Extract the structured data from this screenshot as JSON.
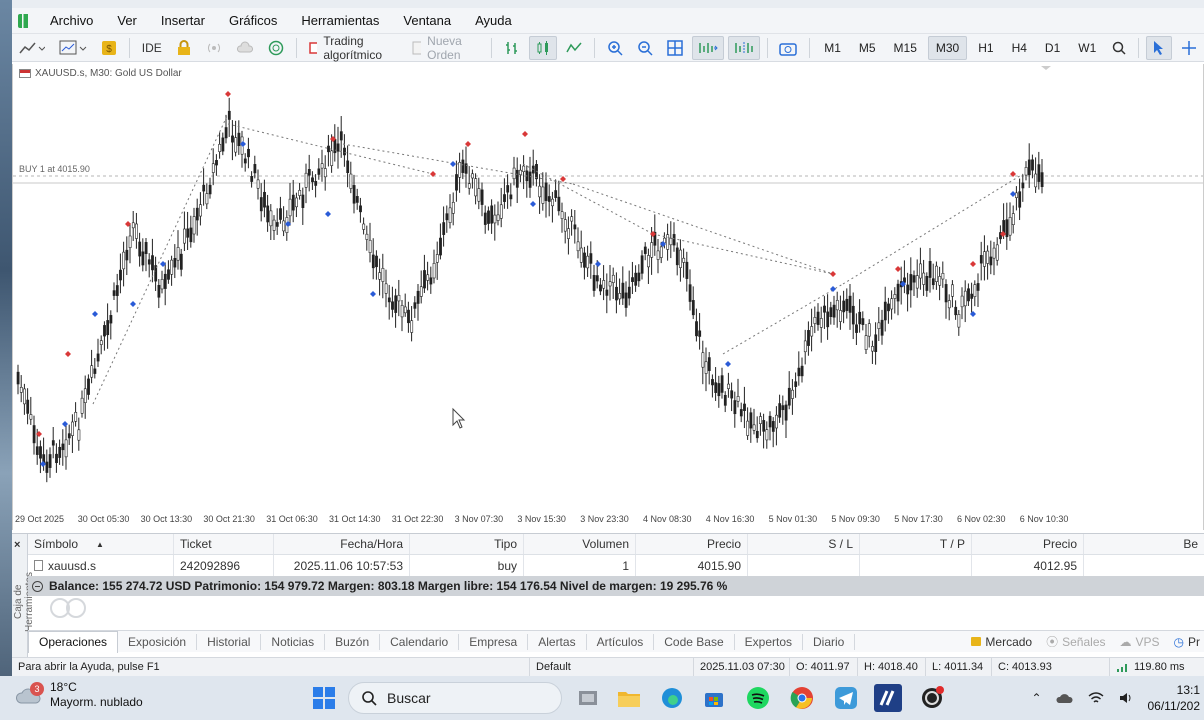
{
  "menubar": {
    "items": [
      "Archivo",
      "Ver",
      "Insertar",
      "Gráficos",
      "Herramientas",
      "Ventana",
      "Ayuda"
    ]
  },
  "toolbar": {
    "ide_label": "IDE",
    "algo_trading_label": "Trading algorítmico",
    "new_order_label": "Nueva Orden",
    "timeframes": [
      "M1",
      "M5",
      "M15",
      "M30",
      "H1",
      "H4",
      "D1",
      "W1"
    ],
    "active_timeframe": "M30"
  },
  "chart": {
    "title": "XAUUSD.s, M30:  Gold US Dollar",
    "buy_line_label": "BUY 1 at 4015.90",
    "dates": [
      "29 Oct 2025",
      "30 Oct 05:30",
      "30 Oct 13:30",
      "30 Oct 21:30",
      "31 Oct 06:30",
      "31 Oct 14:30",
      "31 Oct 22:30",
      "3 Nov 07:30",
      "3 Nov 15:30",
      "3 Nov 23:30",
      "4 Nov 08:30",
      "4 Nov 16:30",
      "5 Nov 01:30",
      "5 Nov 09:30",
      "5 Nov 17:30",
      "6 Nov 02:30",
      "6 Nov 10:30"
    ]
  },
  "terminal": {
    "side_label": "Caja de Herramientas",
    "columns": [
      "Símbolo",
      "Ticket",
      "Fecha/Hora",
      "Tipo",
      "Volumen",
      "Precio",
      "S / L",
      "T / P",
      "Precio",
      "Be"
    ],
    "rows": [
      {
        "symbol": "xauusd.s",
        "ticket": "242092896",
        "datetime": "2025.11.06 10:57:53",
        "type": "buy",
        "volume": "1",
        "price": "4015.90",
        "sl": "",
        "tp": "",
        "current_price": "4012.95"
      }
    ],
    "balance_line": "Balance: 155 274.72 USD  Patrimonio: 154 979.72  Margen: 803.18  Margen libre: 154 176.54  Nivel de margen: 19 295.76 %",
    "tabs": [
      "Operaciones",
      "Exposición",
      "Historial",
      "Noticias",
      "Buzón",
      "Calendario",
      "Empresa",
      "Alertas",
      "Artículos",
      "Code Base",
      "Expertos",
      "Diario"
    ],
    "active_tab": "Operaciones",
    "right_items": [
      "Mercado",
      "Señales",
      "VPS",
      "Pr"
    ]
  },
  "statusbar": {
    "help": "Para abrir la Ayuda, pulse F1",
    "profile": "Default",
    "datetime": "2025.11.03 07:30",
    "open": "O: 4011.97",
    "high": "H: 4018.40",
    "low": "L: 4011.34",
    "close": "C: 4013.93",
    "ping": "119.80 ms"
  },
  "taskbar": {
    "temperature": "18°C",
    "weather": "Mayorm. nublado",
    "weather_badge": "3",
    "search_placeholder": "Buscar",
    "time": "13:1",
    "date": "06/11/202"
  },
  "colors": {
    "bull": "#1f1f1f",
    "buy_marker": "#2a5bd7",
    "sell_marker": "#d93838",
    "accent_active": "#dfe4ea"
  },
  "chart_data": {
    "type": "candlestick",
    "symbol": "XAUUSD.s",
    "timeframe": "M30",
    "open_position_price": 4015.9,
    "last_ohlc": {
      "open": 4011.97,
      "high": 4018.4,
      "low": 4011.34,
      "close": 4013.93
    }
  }
}
